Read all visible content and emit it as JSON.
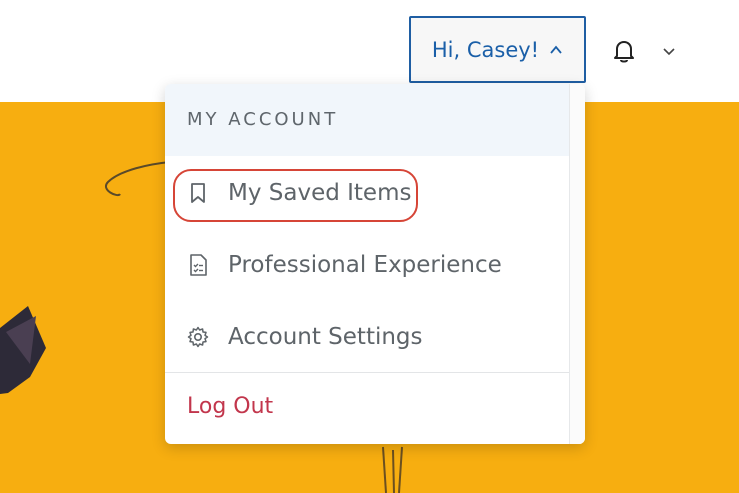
{
  "header": {
    "greeting": "Hi, Casey!",
    "icons": {
      "greeting_caret": "chevron-up-icon",
      "notifications": "bell-icon",
      "more": "chevron-down-icon"
    }
  },
  "menu": {
    "heading": "MY ACCOUNT",
    "items": [
      {
        "label": "My Saved Items",
        "icon": "bookmark-icon",
        "highlighted": true
      },
      {
        "label": "Professional Experience",
        "icon": "document-checklist-icon"
      },
      {
        "label": "Account Settings",
        "icon": "gear-icon"
      }
    ],
    "logout": "Log Out"
  },
  "colors": {
    "accent": "#1a5fa8",
    "hero": "#f7ae10",
    "logout": "#c2364c",
    "highlight": "#d64537"
  }
}
